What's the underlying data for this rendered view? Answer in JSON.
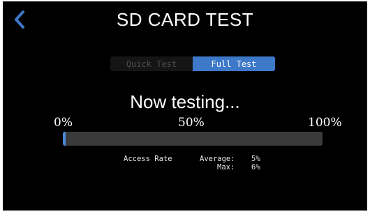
{
  "header": {
    "title": "SD CARD TEST"
  },
  "test_mode": {
    "options": [
      "Quick Test",
      "Full Test"
    ],
    "selected": "Full Test"
  },
  "status": {
    "text": "Now testing..."
  },
  "progress": {
    "label_start": "0%",
    "label_mid": "50%",
    "label_end": "100%",
    "fraction": 0.01
  },
  "access_rate": {
    "label": "Access Rate",
    "average_label": "Average:",
    "average_value": "5%",
    "max_label": "Max:",
    "max_value": "6%"
  },
  "colors": {
    "accent": "#3d78c9",
    "progress_fill": "#4a8ad8",
    "track": "#3a3a3a",
    "background": "#000000"
  },
  "icons": {
    "back": "chevron-left-icon"
  }
}
